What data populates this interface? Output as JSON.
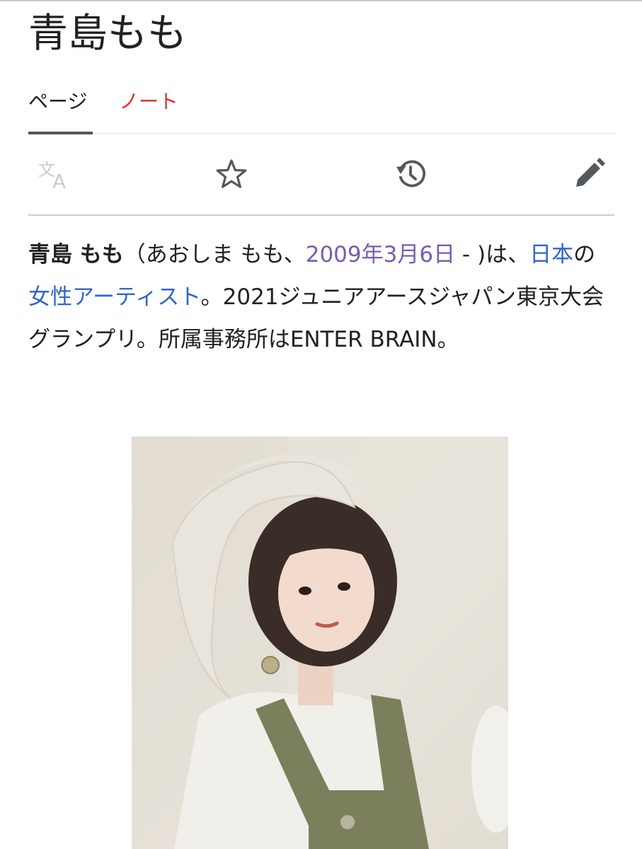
{
  "page": {
    "title": "青島もも"
  },
  "tabs": [
    {
      "label": "ページ",
      "active": true
    },
    {
      "label": "ノート",
      "active": false
    }
  ],
  "actions": {
    "language": "translate-icon",
    "watch": "star-icon",
    "history": "history-icon",
    "edit": "pencil-icon"
  },
  "lead": {
    "name_bold": "青島 もも",
    "open": "（あおしま もも、",
    "birth_link": "2009年3月6日",
    "dash": " - )は、",
    "country_link": "日本",
    "no": "の",
    "profession_link": "女性アーティスト",
    "rest": "。2021ジュニアアースジャパン東京大会グランプリ。所属事務所はENTER BRAIN。"
  },
  "colors": {
    "link": "#3366cc",
    "visited_link": "#795cb2",
    "talk_tab": "#d33333",
    "text": "#202122"
  }
}
